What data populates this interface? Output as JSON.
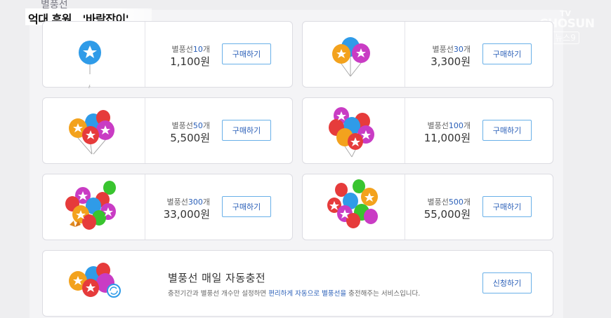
{
  "header": {
    "top_label": "별풍선",
    "caption": "억대 후원…'바람잡이'"
  },
  "logo": {
    "line1": "TV",
    "line2": "CHOSUN",
    "news": "뉴스9"
  },
  "items": [
    {
      "qty_label": "별풍선",
      "qty_num": "10",
      "qty_unit": "개",
      "price": "1,100원",
      "button": "구매하기"
    },
    {
      "qty_label": "별풍선",
      "qty_num": "30",
      "qty_unit": "개",
      "price": "3,300원",
      "button": "구매하기"
    },
    {
      "qty_label": "별풍선",
      "qty_num": "50",
      "qty_unit": "개",
      "price": "5,500원",
      "button": "구매하기"
    },
    {
      "qty_label": "별풍선",
      "qty_num": "100",
      "qty_unit": "개",
      "price": "11,000원",
      "button": "구매하기"
    },
    {
      "qty_label": "별풍선",
      "qty_num": "300",
      "qty_unit": "개",
      "price": "33,000원",
      "button": "구매하기"
    },
    {
      "qty_label": "별풍선",
      "qty_num": "500",
      "qty_unit": "개",
      "price": "55,000원",
      "button": "구매하기"
    }
  ],
  "auto_charge": {
    "title": "별풍선 매일 자동충전",
    "desc_before": "충전기간과 별풍선 개수만 설정하면 ",
    "desc_highlight": "편리하게 자동으로 별풍선을",
    "desc_after": " 충전해주는 서비스입니다.",
    "button": "신청하기"
  },
  "colors": {
    "balloon_blue": "#2f9be8",
    "balloon_red": "#e63b3b",
    "balloon_pink": "#c93cc4",
    "balloon_orange": "#f3a21d",
    "balloon_green": "#39c42f",
    "accent_blue": "#2a5fb8",
    "button_border": "#69b0e8"
  }
}
